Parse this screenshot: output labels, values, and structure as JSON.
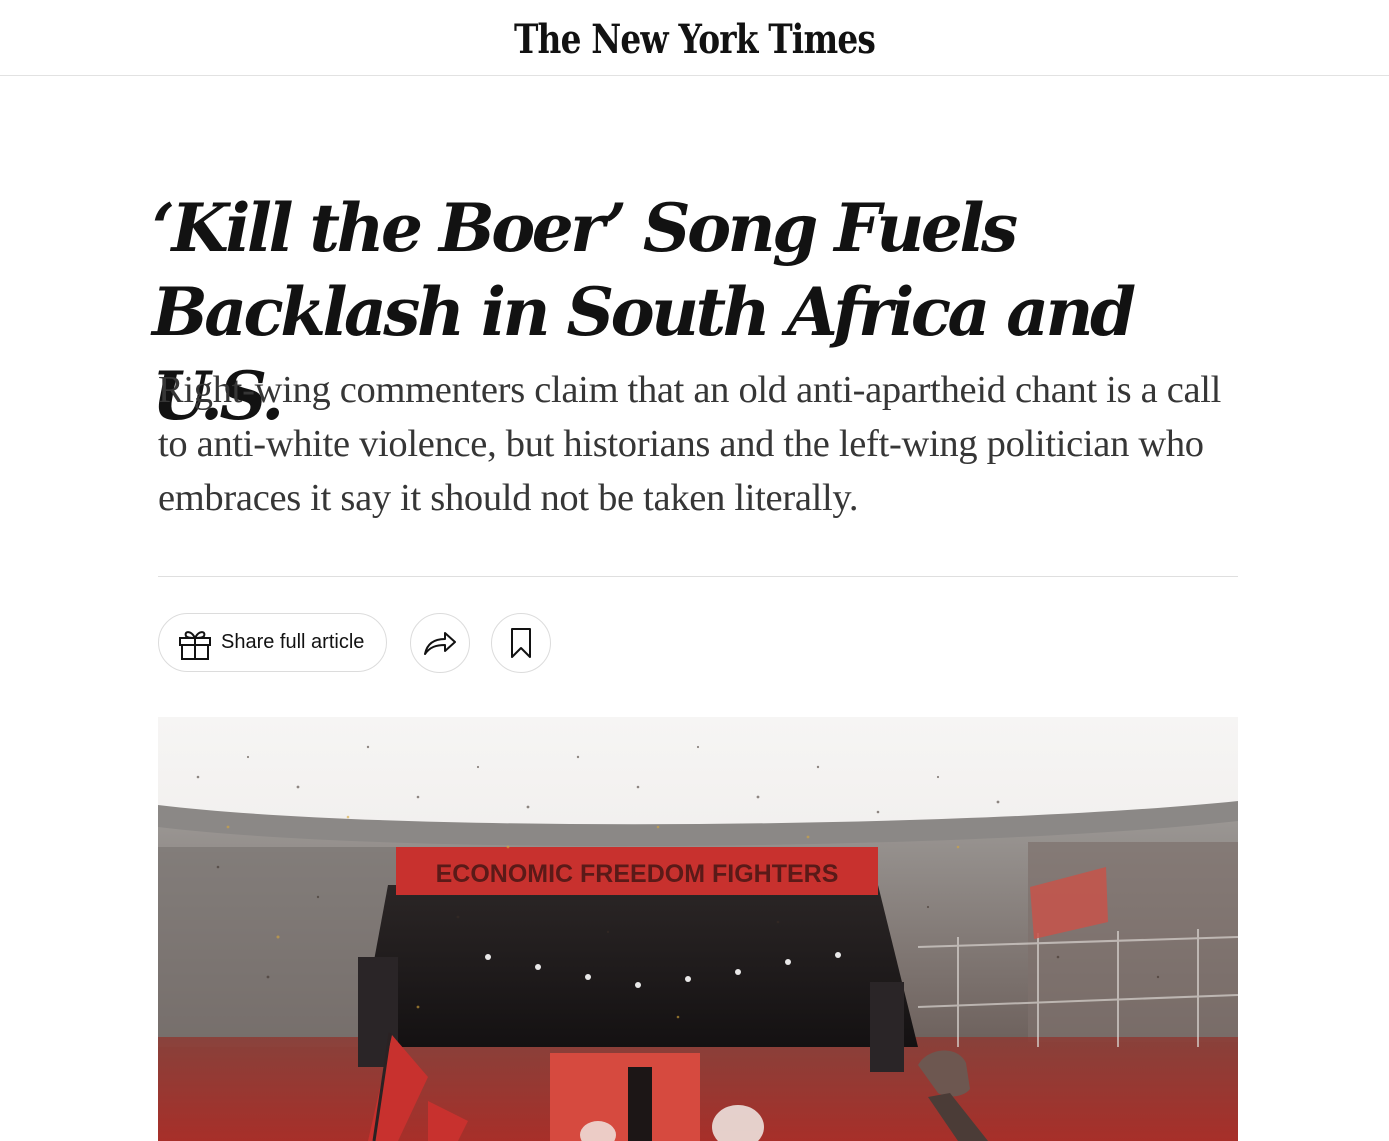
{
  "masthead": {
    "logo_text": "The New York Times"
  },
  "article": {
    "headline": "‘Kill the Boer’ Song Fuels Backlash in South Africa and U.S.",
    "summary": "Right-wing commenters claim that an old anti-apartheid chant is a call to anti-white violence, but historians and the left-wing politician who embraces it say it should not be taken literally."
  },
  "toolbar": {
    "share_full_article_label": "Share full article",
    "share_icon": "share-arrow-icon",
    "save_icon": "bookmark-icon",
    "gift_icon": "gift-icon"
  },
  "hero_image": {
    "stage_banner_text": "ECONOMIC FREEDOM FIGHTERS"
  },
  "colors": {
    "text_primary": "#121212",
    "text_summary": "#363636",
    "divider": "#dfdfdf",
    "button_border": "#dcdcdc",
    "banner_red": "#c8312e"
  }
}
